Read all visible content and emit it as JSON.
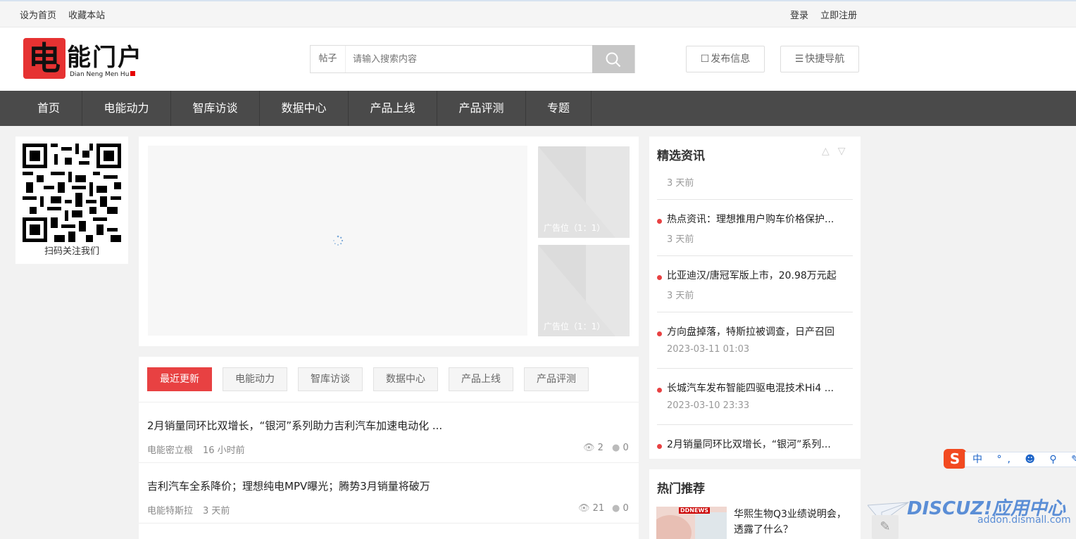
{
  "topbar": {
    "set_home": "设为首页",
    "bookmark": "收藏本站",
    "login": "登录",
    "register": "立即注册"
  },
  "logo": {
    "mark": "电",
    "text": "能门户",
    "sub": "Dian Neng Men Hu"
  },
  "search": {
    "type": "帖子",
    "placeholder": "请输入搜索内容"
  },
  "header_buttons": {
    "publish": "发布信息",
    "quick_nav": "快捷导航"
  },
  "nav": [
    "首页",
    "电能动力",
    "智库访谈",
    "数据中心",
    "产品上线",
    "产品评测",
    "专题"
  ],
  "qr": {
    "caption": "扫码关注我们"
  },
  "slider": {
    "ad_label": "广告位（1：1）"
  },
  "tabs": [
    "最近更新",
    "电能动力",
    "智库访谈",
    "数据中心",
    "产品上线",
    "产品评测"
  ],
  "articles": [
    {
      "title": "2月销量同环比双增长，“银河”系列助力吉利汽车加速电动化 ...",
      "author": "电能密立根",
      "time": "16 小时前",
      "views": "2",
      "comments": "0"
    },
    {
      "title": "吉利汽车全系降价；理想纯电MPV曝光；腾势3月销量将破万",
      "author": "电能特斯拉",
      "time": "3 天前",
      "views": "21",
      "comments": "0"
    }
  ],
  "featured": {
    "heading": "精选资讯",
    "top_date": "3 天前",
    "items": [
      {
        "title": "热点资讯：理想推用户购车价格保护...",
        "date": "3 天前"
      },
      {
        "title": "比亚迪汉/唐冠军版上市，20.98万元起",
        "date": "3 天前"
      },
      {
        "title": "方向盘掉落，特斯拉被调查，日产召回",
        "date": "2023-03-11 01:03"
      },
      {
        "title": "长城汽车发布智能四驱电混技术Hi4 ...",
        "date": "2023-03-10 23:33"
      },
      {
        "title": "2月销量同环比双增长，“银河”系列...",
        "date": ""
      }
    ]
  },
  "hot": {
    "heading": "热门推荐",
    "badge": "DDNEWS",
    "title": "华熙生物Q3业绩说明会，透露了什么？"
  },
  "ime": {
    "logo": "S",
    "icons": "中 °, ☻ ⚲ ✎ ▦ ♣"
  },
  "watermark": {
    "brand": "DISCUZ!应用中心",
    "url": "addon.dismall.com"
  },
  "colors": {
    "accent": "#e84142",
    "nav_bg": "#4a4a4a"
  }
}
